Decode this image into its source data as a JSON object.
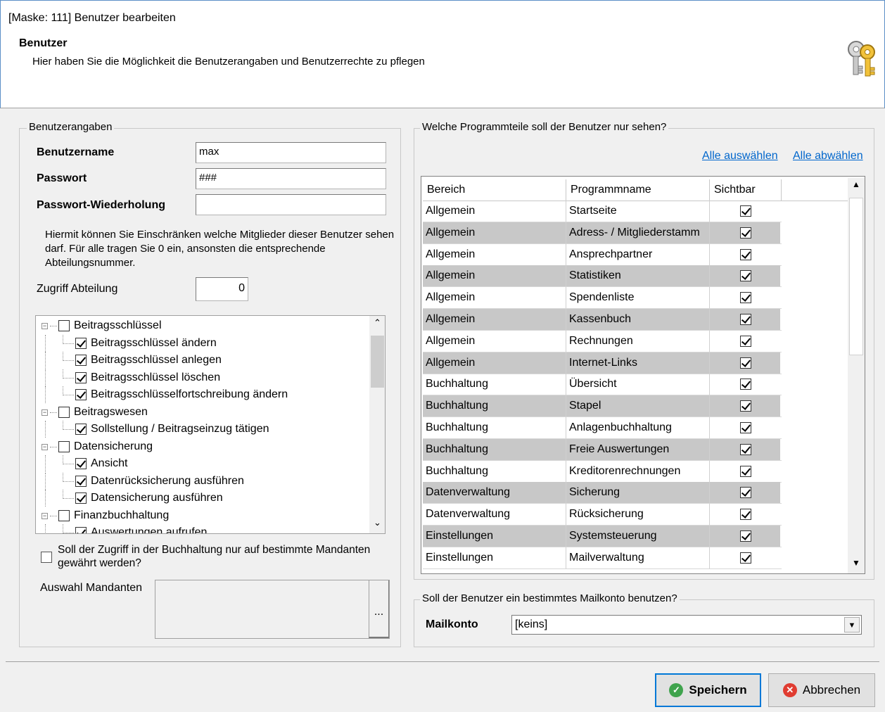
{
  "window": {
    "title": "[Maske: 111] Benutzer bearbeiten",
    "section_title": "Benutzer",
    "section_subtitle": "Hier haben Sie die Möglichkeit die Benutzerangaben und Benutzerrechte zu pflegen"
  },
  "user": {
    "group_label": "Benutzerangaben",
    "username_label": "Benutzername",
    "username_value": "max",
    "password_label": "Passwort",
    "password_value": "###",
    "password_repeat_label": "Passwort-Wiederholung",
    "password_repeat_value": "",
    "dept_note": "Hiermit können Sie Einschränken welche Mitglieder dieser Benutzer sehen darf. Für alle tragen Sie 0 ein, ansonsten die entsprechende Abteilungsnummer.",
    "dept_label": "Zugriff Abteilung",
    "dept_value": "0",
    "mandant_restrict_label": "Soll der Zugriff in der Buchhaltung nur auf bestimmte Mandanten gewährt werden?",
    "mandant_restrict_checked": false,
    "mandant_select_label": "Auswahl Mandanten",
    "mandant_browse_label": "..."
  },
  "tree": [
    {
      "label": "Beitragsschlüssel",
      "level": 0,
      "checked": false
    },
    {
      "label": "Beitragsschlüssel ändern",
      "level": 1,
      "checked": true
    },
    {
      "label": "Beitragsschlüssel anlegen",
      "level": 1,
      "checked": true
    },
    {
      "label": "Beitragsschlüssel löschen",
      "level": 1,
      "checked": true
    },
    {
      "label": "Beitragsschlüsselfortschreibung ändern",
      "level": 1,
      "checked": true
    },
    {
      "label": "Beitragswesen",
      "level": 0,
      "checked": false
    },
    {
      "label": "Sollstellung / Beitragseinzug tätigen",
      "level": 1,
      "checked": true
    },
    {
      "label": "Datensicherung",
      "level": 0,
      "checked": false
    },
    {
      "label": "Ansicht",
      "level": 1,
      "checked": true
    },
    {
      "label": "Datenrücksicherung ausführen",
      "level": 1,
      "checked": true
    },
    {
      "label": "Datensicherung ausführen",
      "level": 1,
      "checked": true
    },
    {
      "label": "Finanzbuchhaltung",
      "level": 0,
      "checked": false
    },
    {
      "label": "Auswertungen aufrufen",
      "level": 1,
      "checked": true
    }
  ],
  "programs": {
    "group_label": "Welche Programmteile soll der Benutzer nur sehen?",
    "select_all": "Alle auswählen",
    "deselect_all": "Alle abwählen",
    "columns": [
      "Bereich",
      "Programmname",
      "Sichtbar"
    ],
    "rows": [
      {
        "area": "Allgemein",
        "program": "Startseite",
        "visible": true
      },
      {
        "area": "Allgemein",
        "program": "Adress- / Mitgliederstamm",
        "visible": true
      },
      {
        "area": "Allgemein",
        "program": "Ansprechpartner",
        "visible": true
      },
      {
        "area": "Allgemein",
        "program": "Statistiken",
        "visible": true
      },
      {
        "area": "Allgemein",
        "program": "Spendenliste",
        "visible": true
      },
      {
        "area": "Allgemein",
        "program": "Kassenbuch",
        "visible": true
      },
      {
        "area": "Allgemein",
        "program": "Rechnungen",
        "visible": true
      },
      {
        "area": "Allgemein",
        "program": "Internet-Links",
        "visible": true
      },
      {
        "area": "Buchhaltung",
        "program": "Übersicht",
        "visible": true
      },
      {
        "area": "Buchhaltung",
        "program": "Stapel",
        "visible": true
      },
      {
        "area": "Buchhaltung",
        "program": "Anlagenbuchhaltung",
        "visible": true
      },
      {
        "area": "Buchhaltung",
        "program": "Freie Auswertungen",
        "visible": true
      },
      {
        "area": "Buchhaltung",
        "program": "Kreditorenrechnungen",
        "visible": true
      },
      {
        "area": "Datenverwaltung",
        "program": "Sicherung",
        "visible": true
      },
      {
        "area": "Datenverwaltung",
        "program": "Rücksicherung",
        "visible": true
      },
      {
        "area": "Einstellungen",
        "program": "Systemsteuerung",
        "visible": true
      },
      {
        "area": "Einstellungen",
        "program": "Mailverwaltung",
        "visible": true
      }
    ]
  },
  "mail": {
    "group_label": "Soll der Benutzer ein bestimmtes Mailkonto benutzen?",
    "label": "Mailkonto",
    "value": "[keins]"
  },
  "buttons": {
    "save": "Speichern",
    "cancel": "Abbrechen"
  },
  "colors": {
    "accent": "#0078d7",
    "link": "#0066cc",
    "alt_row": "#c8c8c8"
  }
}
